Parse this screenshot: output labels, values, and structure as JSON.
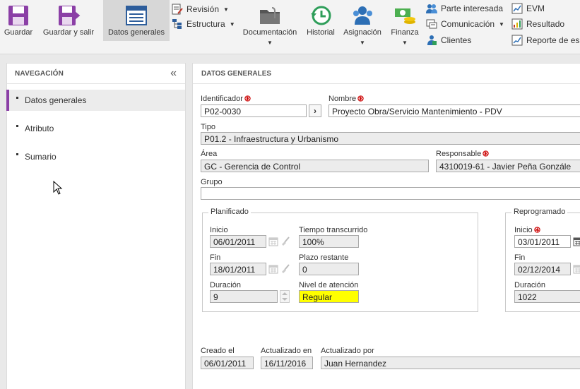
{
  "toolbar": {
    "save": "Guardar",
    "save_exit": "Guardar y salir",
    "general_data": "Datos generales",
    "revision": "Revisión",
    "structure": "Estructura",
    "documentation": "Documentación",
    "history": "Historial",
    "assignment": "Asignación",
    "finance": "Finanza",
    "stakeholder": "Parte interesada",
    "communication": "Comunicación",
    "clients": "Clientes",
    "evm": "EVM",
    "result": "Resultado",
    "report": "Reporte de es"
  },
  "nav": {
    "title": "NAVEGACIÓN",
    "items": [
      {
        "label": "Datos generales"
      },
      {
        "label": "Atributo"
      },
      {
        "label": "Sumario"
      }
    ]
  },
  "main": {
    "title": "DATOS GENERALES",
    "identifier": {
      "label": "Identificador",
      "value": "P02-0030"
    },
    "name": {
      "label": "Nombre",
      "value": "Proyecto Obra/Servicio Mantenimiento - PDV"
    },
    "type": {
      "label": "Tipo",
      "value": "P01.2 - Infraestructura y Urbanismo"
    },
    "area": {
      "label": "Área",
      "value": "GC - Gerencia de Control"
    },
    "responsible": {
      "label": "Responsable",
      "value": "4310019-61 - Javier Peña Gonzále"
    },
    "group": {
      "label": "Grupo",
      "value": ""
    },
    "planned": {
      "title": "Planificado",
      "start_label": "Inicio",
      "start": "06/01/2011",
      "end_label": "Fin",
      "end": "18/01/2011",
      "duration_label": "Duración",
      "duration": "9",
      "elapsed_label": "Tiempo transcurrido",
      "elapsed": "100%",
      "remaining_label": "Plazo restante",
      "remaining": "0",
      "attention_label": "Nivel de atención",
      "attention": "Regular"
    },
    "rescheduled": {
      "title": "Reprogramado",
      "start_label": "Inicio",
      "start": "03/01/2011",
      "end_label": "Fin",
      "end": "02/12/2014",
      "duration_label": "Duración",
      "duration": "1022"
    },
    "created_label": "Creado el",
    "created": "06/01/2011",
    "updated_label": "Actualizado en",
    "updated": "16/11/2016",
    "updated_by_label": "Actualizado por",
    "updated_by": "Juan Hernandez"
  },
  "colors": {
    "accent": "#8b3fa6",
    "attention_bg": "#ffff00",
    "required": "#cc0000"
  }
}
